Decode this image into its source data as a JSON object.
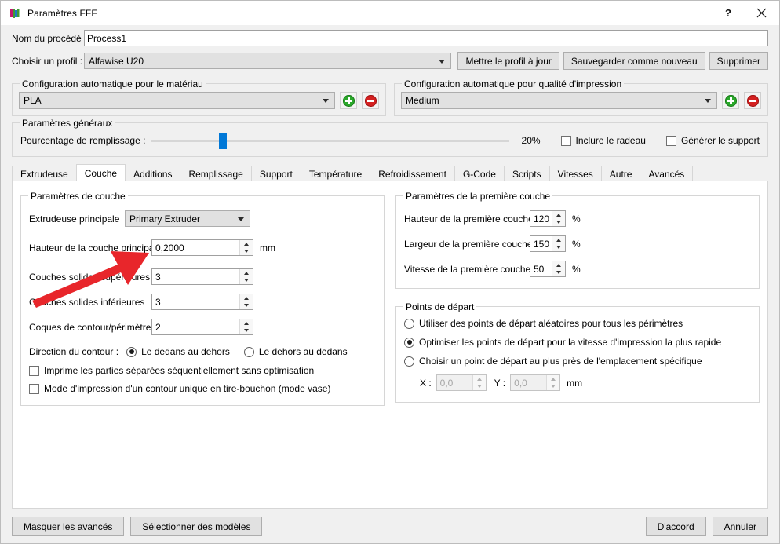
{
  "window": {
    "title": "Paramètres FFF",
    "icon": "app-logo-icon",
    "help_label": "?",
    "close_label": "✕"
  },
  "form": {
    "process_name_label": "Nom du procédé :",
    "process_name_value": "Process1",
    "profile_label": "Choisir un profil :",
    "profile_value": "Alfawise U20",
    "update_profile_button": "Mettre le profil à jour",
    "save_as_new_button": "Sauvegarder comme nouveau",
    "delete_button": "Supprimer"
  },
  "auto_config": {
    "material": {
      "title": "Configuration automatique pour le matériau",
      "value": "PLA",
      "add_label": "+",
      "remove_label": "−"
    },
    "quality": {
      "title": "Configuration automatique pour qualité d'impression",
      "value": "Medium",
      "add_label": "+",
      "remove_label": "−"
    }
  },
  "general": {
    "title": "Paramètres généraux",
    "infill_label": "Pourcentage de remplissage :",
    "infill_percent": 20,
    "infill_percent_text": "20%",
    "include_raft_label": "Inclure le radeau",
    "include_raft_checked": false,
    "generate_support_label": "Générer le support",
    "generate_support_checked": false
  },
  "tabs": {
    "active_index": 1,
    "items": [
      {
        "label": "Extrudeuse"
      },
      {
        "label": "Couche"
      },
      {
        "label": "Additions"
      },
      {
        "label": "Remplissage"
      },
      {
        "label": "Support"
      },
      {
        "label": "Température"
      },
      {
        "label": "Refroidissement"
      },
      {
        "label": "G-Code"
      },
      {
        "label": "Scripts"
      },
      {
        "label": "Vitesses"
      },
      {
        "label": "Autre"
      },
      {
        "label": "Avancés"
      }
    ]
  },
  "layer_settings": {
    "title": "Paramètres de couche",
    "primary_extruder_label": "Extrudeuse principale",
    "primary_extruder_value": "Primary Extruder",
    "primary_layer_height_label": "Hauteur de la couche principale",
    "primary_layer_height_value": "0,2000",
    "primary_layer_height_unit": "mm",
    "top_solid_layers_label": "Couches solides supérieures",
    "top_solid_layers_value": "3",
    "bottom_solid_layers_label": "Couches solides inférieures",
    "bottom_solid_layers_value": "3",
    "outline_shells_label": "Coques de contour/périmètre",
    "outline_shells_value": "2",
    "outline_direction_label": "Direction du contour :",
    "outline_inside_out_label": "Le dedans au dehors",
    "outline_outside_in_label": "Le dehors au dedans",
    "outline_direction_selected": "inside_out",
    "sequential_label": "Imprime les parties séparées séquentiellement sans optimisation",
    "sequential_checked": false,
    "vase_mode_label": "Mode d'impression d'un contour unique en tire-bouchon (mode vase)",
    "vase_mode_checked": false
  },
  "first_layer": {
    "title": "Paramètres de la première couche",
    "height_label": "Hauteur de la première couche",
    "height_value": "120",
    "height_unit": "%",
    "width_label": "Largeur de la première couche",
    "width_value": "150",
    "width_unit": "%",
    "speed_label": "Vitesse de la première couche",
    "speed_value": "50",
    "speed_unit": "%"
  },
  "start_points": {
    "title": "Points de départ",
    "random_label": "Utiliser des points de départ aléatoires pour tous les périmètres",
    "optimize_label": "Optimiser les points de départ pour la vitesse d'impression la plus rapide",
    "specific_label": "Choisir un point de départ au plus près de l'emplacement spécifique",
    "selected": "optimize",
    "x_label": "X :",
    "x_value": "0,0",
    "y_label": "Y :",
    "y_value": "0,0",
    "unit": "mm"
  },
  "bottom_bar": {
    "hide_advanced_button": "Masquer les avancés",
    "select_models_button": "Sélectionner des modèles",
    "ok_button": "D'accord",
    "cancel_button": "Annuler"
  },
  "annotation": {
    "type": "red-arrow",
    "color": "#e8262b",
    "points_at": "primary-layer-height-field"
  },
  "colors": {
    "accent_blue": "#0078d7",
    "add_green": "#2aa82a",
    "remove_red": "#d42020",
    "annotation_red": "#e8262b",
    "window_bg": "#f0f0f0",
    "panel_bg": "#ffffff"
  }
}
